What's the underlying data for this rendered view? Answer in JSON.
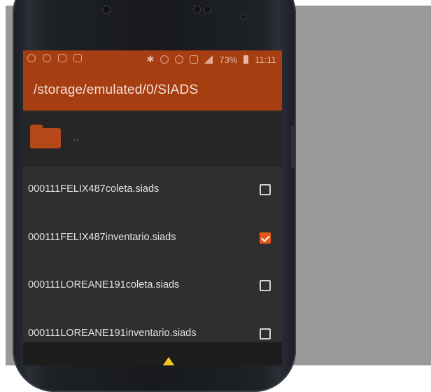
{
  "status_bar": {
    "battery_text": "73%",
    "time": "11:11"
  },
  "header": {
    "path": "/storage/emulated/0/SIADS"
  },
  "parent_entry": {
    "label": ".."
  },
  "files": [
    {
      "name": "000111FELIX487coleta.siads",
      "checked": false
    },
    {
      "name": "000111FELIX487inventario.siads",
      "checked": true
    },
    {
      "name": "000111LOREANE191coleta.siads",
      "checked": false
    },
    {
      "name": "000111LOREANE191inventario.siads",
      "checked": false
    }
  ],
  "colors": {
    "accent": "#a63e12",
    "checkbox_checked": "#e8571a",
    "folder": "#b5471a",
    "warning": "#f3c623"
  }
}
